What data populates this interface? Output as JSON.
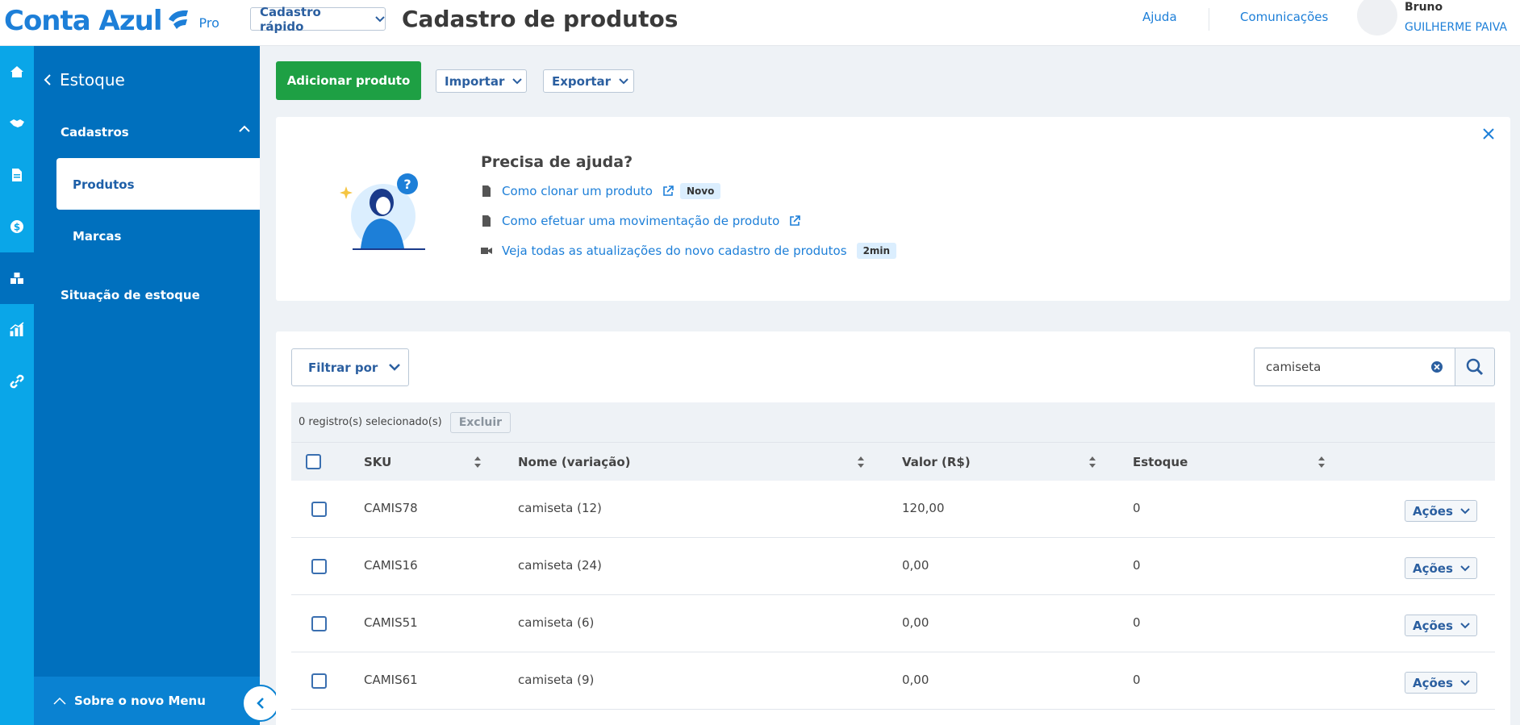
{
  "header": {
    "logo_text": "Conta Azul",
    "logo_pro": "Pro",
    "quick_register": "Cadastro rápido",
    "page_title": "Cadastro de produtos",
    "help": "Ajuda",
    "communications": "Comunicações",
    "user_name": "Bruno",
    "user_company": "GUILHERME PAIVA"
  },
  "rail": [
    "home-icon",
    "handshake-icon",
    "document-icon",
    "money-icon",
    "boxes-icon",
    "chart-icon",
    "link-icon"
  ],
  "sidebar": {
    "back_label": "Estoque",
    "section": "Cadastros",
    "active_item": "Produtos",
    "sub_item": "Marcas",
    "stock_situation": "Situação de estoque",
    "footer": "Sobre o novo Menu"
  },
  "toolbar": {
    "add_product": "Adicionar produto",
    "import": "Importar",
    "export": "Exportar"
  },
  "help_card": {
    "title": "Precisa de ajuda?",
    "items": [
      {
        "label": "Como clonar um produto",
        "badge": "Novo"
      },
      {
        "label": "Como efetuar uma movimentação de produto",
        "badge": ""
      },
      {
        "label": "Veja todas as atualizações do novo cadastro de produtos",
        "badge": "2min"
      }
    ]
  },
  "table": {
    "filter": "Filtrar por",
    "search_value": "camiseta",
    "selected_text": "0 registro(s) selecionado(s)",
    "delete": "Excluir",
    "columns": [
      "SKU",
      "Nome (variação)",
      "Valor (R$)",
      "Estoque"
    ],
    "actions_label": "Ações",
    "rows": [
      {
        "sku": "CAMIS78",
        "name": "camiseta (12)",
        "value": "120,00",
        "stock": "0"
      },
      {
        "sku": "CAMIS16",
        "name": "camiseta (24)",
        "value": "0,00",
        "stock": "0"
      },
      {
        "sku": "CAMIS51",
        "name": "camiseta (6)",
        "value": "0,00",
        "stock": "0"
      },
      {
        "sku": "CAMIS61",
        "name": "camiseta (9)",
        "value": "0,00",
        "stock": "0"
      }
    ]
  },
  "colors": {
    "brand_blue": "#1d7fd8",
    "sidebar": "#0070be",
    "rail": "#0aa6e8",
    "primary_green": "#1ea044"
  }
}
